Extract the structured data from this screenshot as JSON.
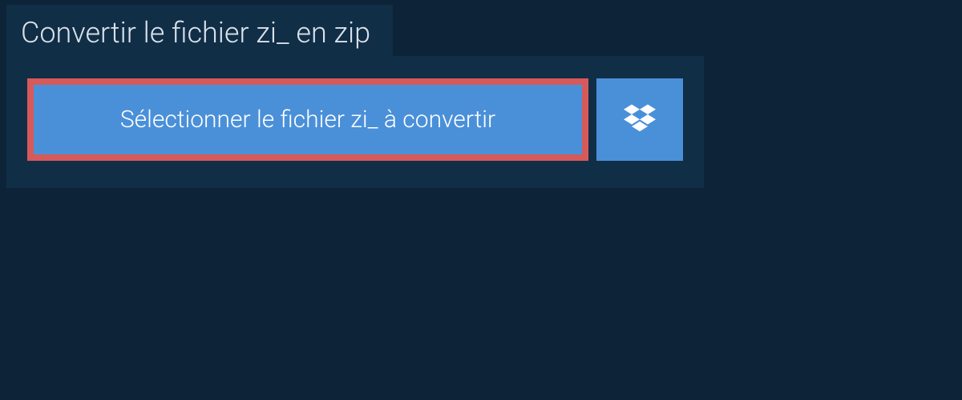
{
  "title": "Convertir le fichier zi_ en zip",
  "buttons": {
    "select_label": "Sélectionner le fichier zi_ à convertir"
  },
  "colors": {
    "page_bg": "#0d2438",
    "panel_bg": "#112e47",
    "button_bg": "#4a90d9",
    "highlight_border": "#d65a5a",
    "text_light": "#d9e2ea",
    "text_white": "#ffffff"
  }
}
